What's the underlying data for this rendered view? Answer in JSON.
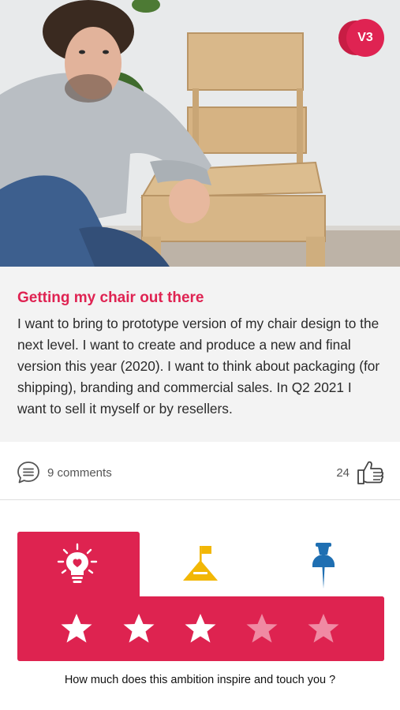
{
  "hero": {
    "version_badge": "V3",
    "photo_description_icon": "person-with-chair-photo"
  },
  "story": {
    "title": "Getting my chair out there",
    "body": "I want to bring to prototype version of my chair design to the next level. I want to create and produce a new and final version this year (2020). I want to think about packaging (for shipping), branding and commercial sales. In Q2 2021 I want to sell it myself or by resellers."
  },
  "social": {
    "comments_label": "9 comments",
    "comments_icon": "speech-bubble-list-icon",
    "likes_count": "24",
    "likes_icon": "thumbs-up-icon"
  },
  "rating": {
    "categories": [
      {
        "icon": "lightbulb-heart-icon",
        "selected": true
      },
      {
        "icon": "flag-mountain-icon",
        "selected": false
      },
      {
        "icon": "pushpin-icon",
        "selected": false
      }
    ],
    "stars_total": 5,
    "stars_filled": 3,
    "question": "How much does this ambition inspire and touch you ?"
  },
  "colors": {
    "accent": "#df2352",
    "star_filled": "#ffffff",
    "star_empty": "#f08aa3",
    "flag_yellow": "#f2b705",
    "pin_blue": "#1f6fb2"
  }
}
